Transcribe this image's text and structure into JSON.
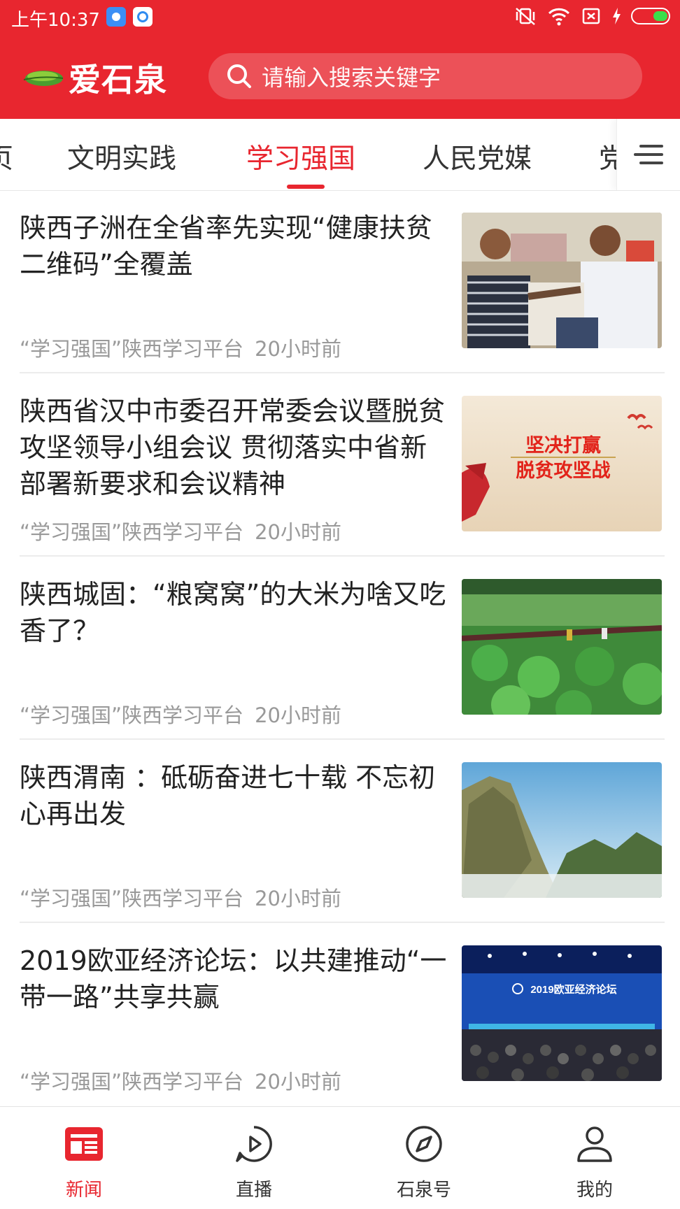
{
  "status_bar": {
    "time": "上午10:37"
  },
  "header": {
    "logo_text": "爱石泉",
    "search_placeholder": "请输入搜索关键字"
  },
  "tabs": [
    {
      "label": "页"
    },
    {
      "label": "文明实践"
    },
    {
      "label": "学习强国",
      "active": true
    },
    {
      "label": "人民党媒"
    },
    {
      "label": "党"
    }
  ],
  "news": [
    {
      "title": "陕西子洲在全省率先实现“健康扶贫二维码”全覆盖",
      "source": "“学习强国”陕西学习平台",
      "time": "20小时前"
    },
    {
      "title": "陕西省汉中市委召开常委会议暨脱贫攻坚领导小组会议 贯彻落实中省新部署新要求和会议精神",
      "source": "“学习强国”陕西学习平台",
      "time": "20小时前",
      "image_text": [
        "坚决打赢",
        "脱贫攻坚战"
      ]
    },
    {
      "title": "陕西城固：“粮窝窝”的大米为啥又吃香了？",
      "source": "“学习强国”陕西学习平台",
      "time": "20小时前"
    },
    {
      "title": "陕西渭南 ：砥砺奋进七十载 不忘初心再出发",
      "source": "“学习强国”陕西学习平台",
      "time": "20小时前"
    },
    {
      "title": "2019欧亚经济论坛：以共建推动“一带一路”共享共赢",
      "source": "“学习强国”陕西学习平台",
      "time": "20小时前",
      "image_text": [
        "2019欧亚经济论坛"
      ]
    }
  ],
  "bottom_nav": [
    {
      "label": "新闻",
      "icon": "news-icon",
      "active": true
    },
    {
      "label": "直播",
      "icon": "live-play-icon"
    },
    {
      "label": "石泉号",
      "icon": "compass-icon"
    },
    {
      "label": "我的",
      "icon": "user-icon"
    }
  ],
  "colors": {
    "brand_red": "#e8262f",
    "text": "#222222",
    "meta": "#999999"
  }
}
